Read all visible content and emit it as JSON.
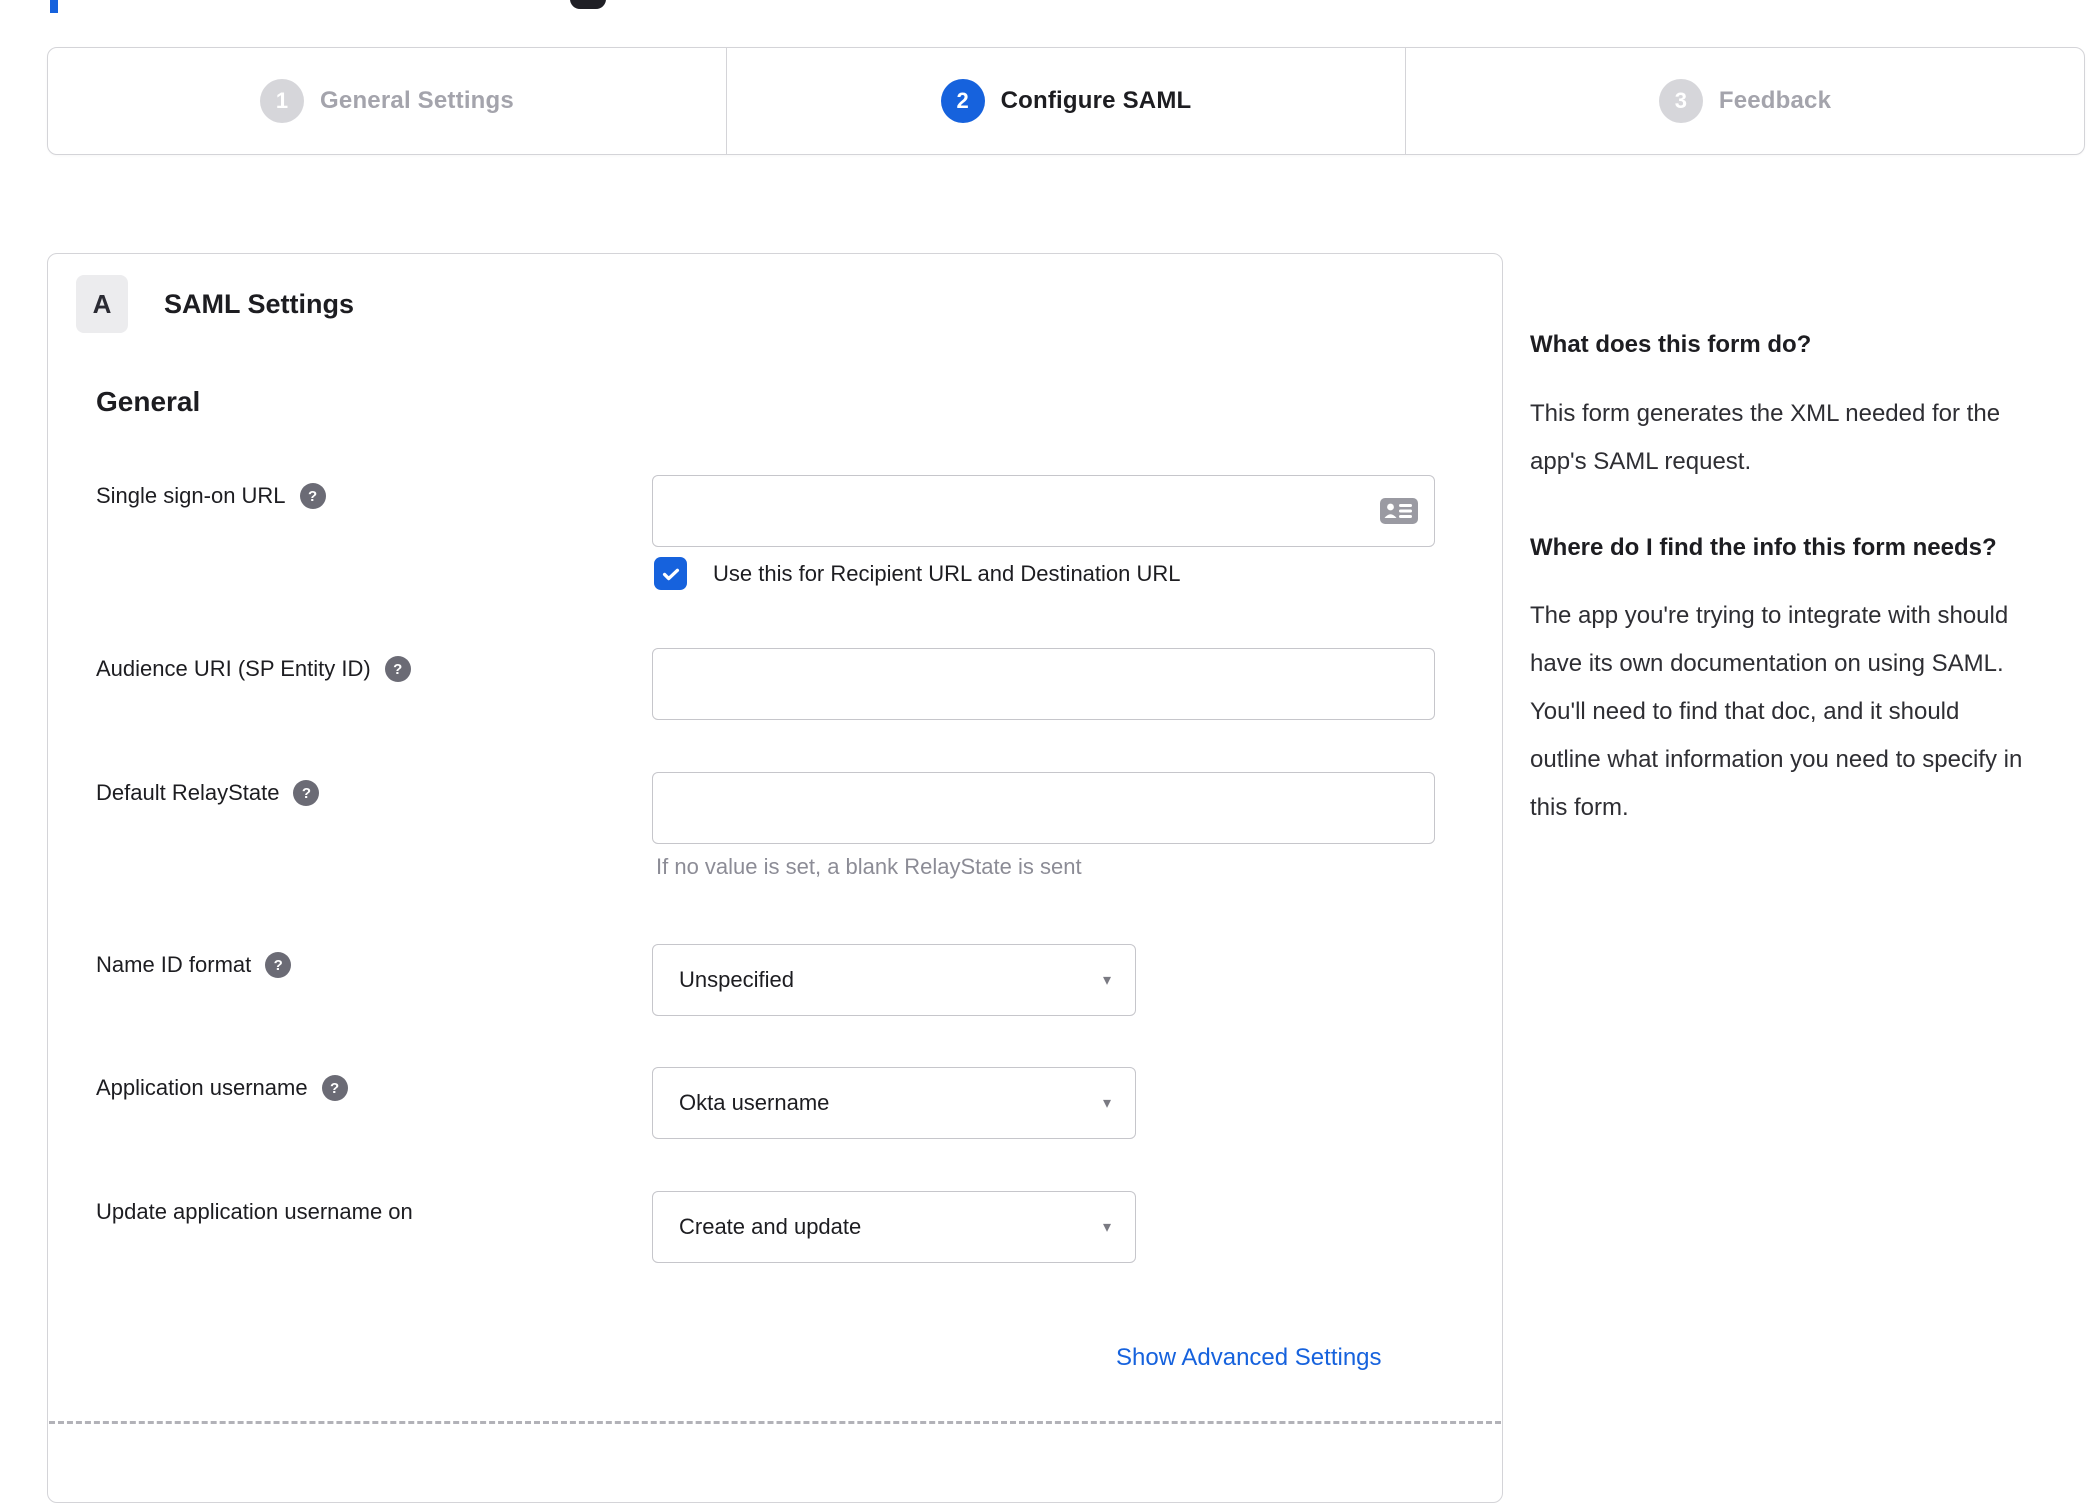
{
  "colors": {
    "accent_blue": "#1662dd",
    "inactive_gray": "#a4a4ac",
    "border_gray": "#d4d4d8"
  },
  "icons": {
    "help": "?",
    "caret": "▾"
  },
  "stepper": {
    "steps": [
      {
        "number": "1",
        "label": "General Settings",
        "state": "inactive"
      },
      {
        "number": "2",
        "label": "Configure SAML",
        "state": "active"
      },
      {
        "number": "3",
        "label": "Feedback",
        "state": "inactive"
      }
    ]
  },
  "panel": {
    "badge": "A",
    "title": "SAML Settings",
    "section_heading": "General",
    "fields": [
      {
        "label": "Single sign-on URL",
        "has_help": true,
        "type": "text",
        "value": "",
        "checkbox_label": "Use this for Recipient URL and Destination URL",
        "checkbox_checked": true
      },
      {
        "label": "Audience URI (SP Entity ID)",
        "has_help": true,
        "type": "text",
        "value": ""
      },
      {
        "label": "Default RelayState",
        "has_help": true,
        "type": "text",
        "value": "",
        "hint": "If no value is set, a blank RelayState is sent"
      },
      {
        "label": "Name ID format",
        "has_help": true,
        "type": "select",
        "value": "Unspecified"
      },
      {
        "label": "Application username",
        "has_help": true,
        "type": "select",
        "value": "Okta username"
      },
      {
        "label": "Update application username on",
        "has_help": false,
        "type": "select",
        "value": "Create and update"
      }
    ],
    "show_advanced_label": "Show Advanced Settings"
  },
  "sidebar": {
    "sections": [
      {
        "heading": "What does this form do?",
        "body": "This form generates the XML needed for the app's SAML request."
      },
      {
        "heading": "Where do I find the info this form needs?",
        "body": "The app you're trying to integrate with should have its own documentation on using SAML. You'll need to find that doc, and it should outline what information you need to specify in this form."
      }
    ]
  }
}
